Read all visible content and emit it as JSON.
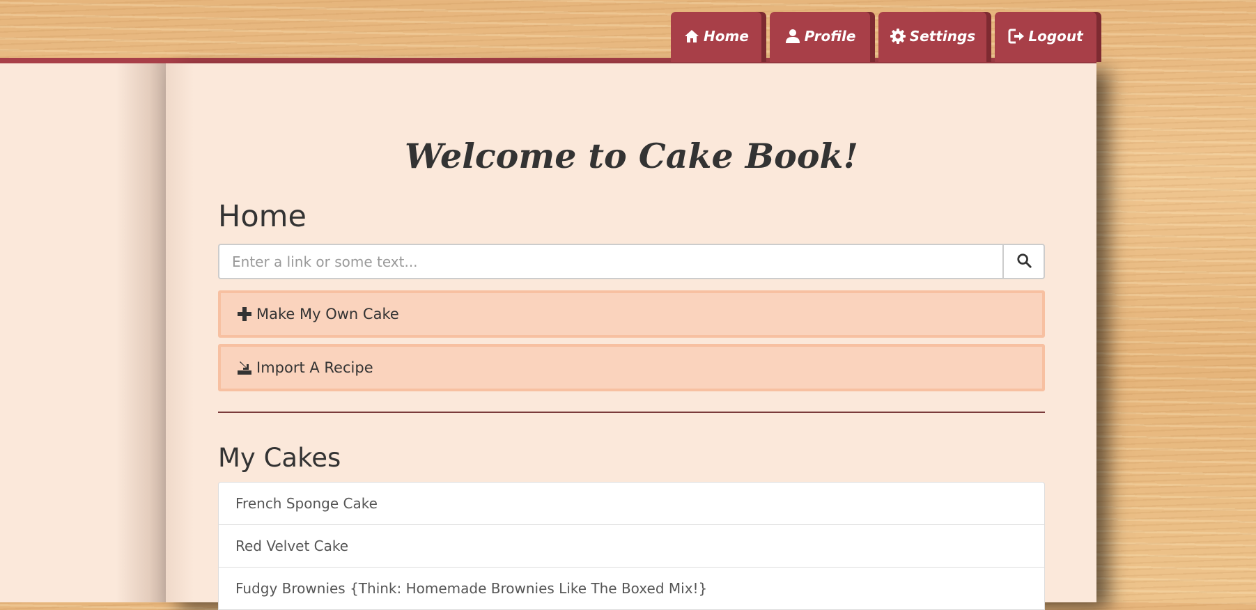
{
  "nav": {
    "tabs": [
      {
        "label": "Home",
        "icon": "home-icon"
      },
      {
        "label": "Profile",
        "icon": "user-icon"
      },
      {
        "label": "Settings",
        "icon": "gear-icon"
      },
      {
        "label": "Logout",
        "icon": "logout-icon"
      }
    ]
  },
  "main": {
    "welcome_title": "Welcome to Cake Book!",
    "section_title": "Home",
    "search": {
      "placeholder": "Enter a link or some text...",
      "value": "",
      "button_icon": "search-icon"
    },
    "actions": [
      {
        "label": "Make My Own Cake",
        "icon": "plus-icon"
      },
      {
        "label": "Import A Recipe",
        "icon": "import-icon"
      }
    ],
    "cakes_title": "My Cakes",
    "cakes": [
      "French Sponge Cake",
      "Red Velvet Cake",
      "Fudgy Brownies {Think: Homemade Brownies Like The Boxed Mix!}"
    ]
  },
  "colors": {
    "accent": "#a83f48",
    "page": "#fbe8da",
    "action_bg": "#fad3bd",
    "action_border": "#f7c0a1",
    "text": "#333333"
  }
}
